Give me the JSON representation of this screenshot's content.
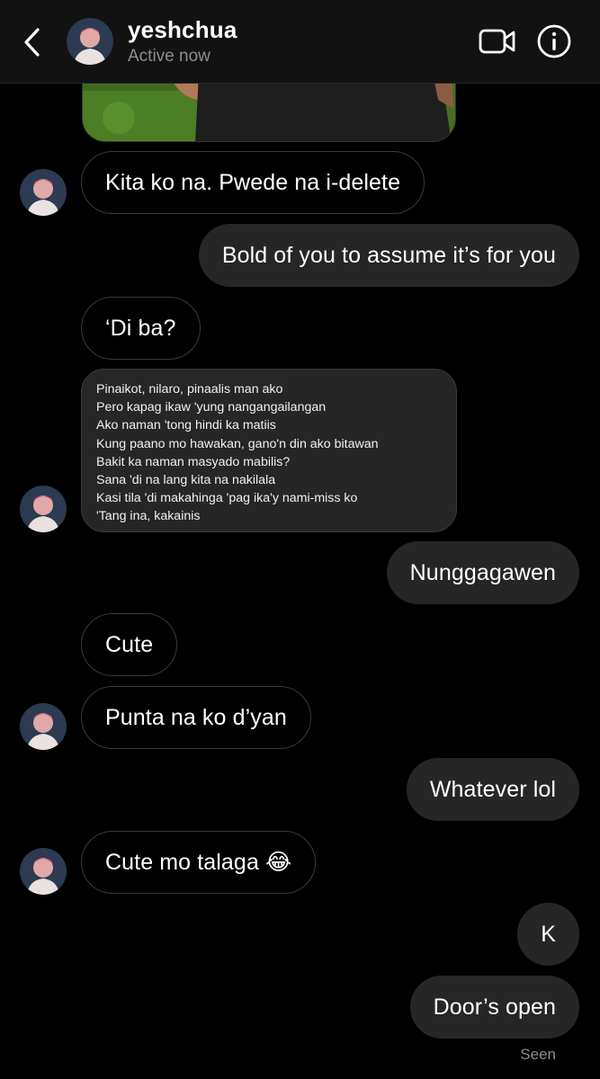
{
  "header": {
    "username": "yeshchua",
    "status": "Active now"
  },
  "icons": {
    "back": "chevron-left-icon",
    "video_call": "video-camera-icon",
    "info": "info-circle-icon"
  },
  "messages": [
    {
      "sender": "them",
      "text": "Kita ko na. Pwede na i-delete"
    },
    {
      "sender": "me",
      "text": "Bold of you to assume it’s for you"
    },
    {
      "sender": "them",
      "text": "‘Di ba?"
    },
    {
      "sender": "them",
      "type": "lyrics",
      "lines": [
        "Pinaikot, nilaro, pinaalis man ako",
        "Pero kapag ikaw 'yung nangangailangan",
        "Ako naman 'tong hindi ka matiis",
        "Kung paano mo hawakan, gano'n din ako bitawan",
        "Bakit ka naman masyado mabilis?",
        "Sana 'di na lang kita na nakilala",
        "Kasi tila 'di makahinga 'pag ika'y nami-miss ko",
        "'Tang ina, kakainis"
      ]
    },
    {
      "sender": "me",
      "text": "Nunggagawen"
    },
    {
      "sender": "them",
      "text": "Cute"
    },
    {
      "sender": "them",
      "text": "Punta na ko d’yan"
    },
    {
      "sender": "me",
      "text": "Whatever lol"
    },
    {
      "sender": "them",
      "text": "Cute mo talaga 😂"
    },
    {
      "sender": "me",
      "text": "K"
    },
    {
      "sender": "me",
      "text": "Door’s open"
    }
  ],
  "seen_label": "Seen",
  "colors": {
    "background": "#000000",
    "header": "#121212",
    "outgoing_bubble": "#262626",
    "incoming_border": "#3a3a3a",
    "secondary_text": "#8e8e8e"
  }
}
